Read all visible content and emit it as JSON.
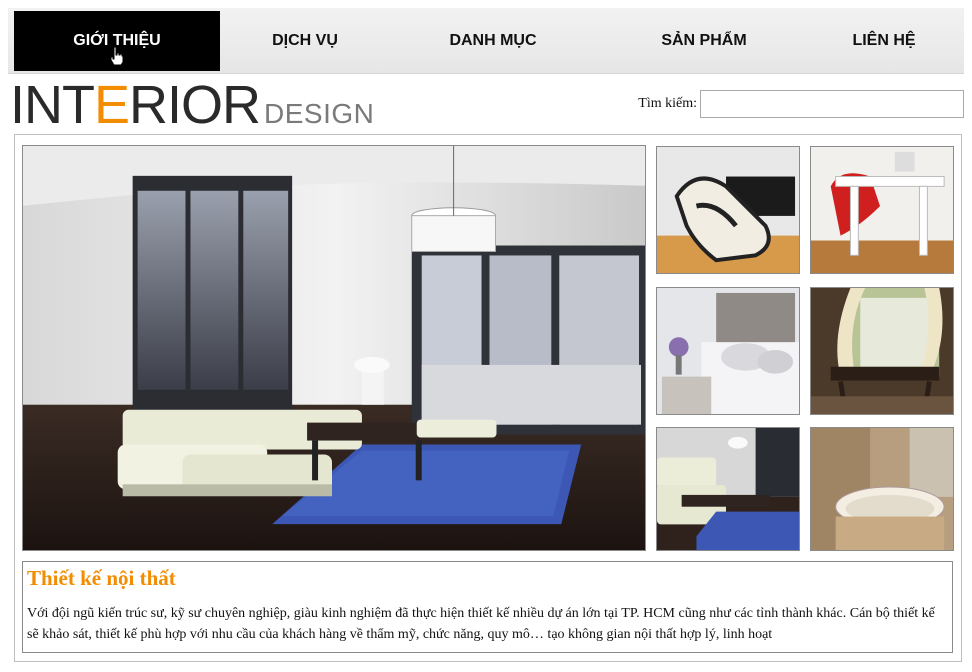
{
  "nav": {
    "items": [
      {
        "label": "GIỚI THIỆU",
        "active": true
      },
      {
        "label": "DỊCH VỤ",
        "active": false
      },
      {
        "label": "DANH MỤC",
        "active": false
      },
      {
        "label": "SẢN PHẨM",
        "active": false
      },
      {
        "label": "LIÊN HỆ",
        "active": false
      }
    ]
  },
  "logo": {
    "main_prefix": "INT",
    "main_accent": "E",
    "main_suffix": "RIOR",
    "sub": "DESIGN"
  },
  "search": {
    "label": "Tìm kiếm:",
    "value": ""
  },
  "info": {
    "title": "Thiết kế nội thất",
    "text": "Với đội ngũ kiến trúc sư, kỹ sư chuyên nghiệp, giàu kinh nghiệm đã thực hiện thiết kế nhiều dự án lớn tại TP. HCM cũng như các tỉnh thành khác. Cán bộ thiết kế sẽ khảo sát, thiết kế phù hợp với nhu cầu của khách hàng về thẩm mỹ, chức năng, quy mô… tạo không gian nội thất hợp lý, linh hoạt"
  },
  "colors": {
    "accent": "#f28c00",
    "nav_active_bg": "#000000"
  }
}
